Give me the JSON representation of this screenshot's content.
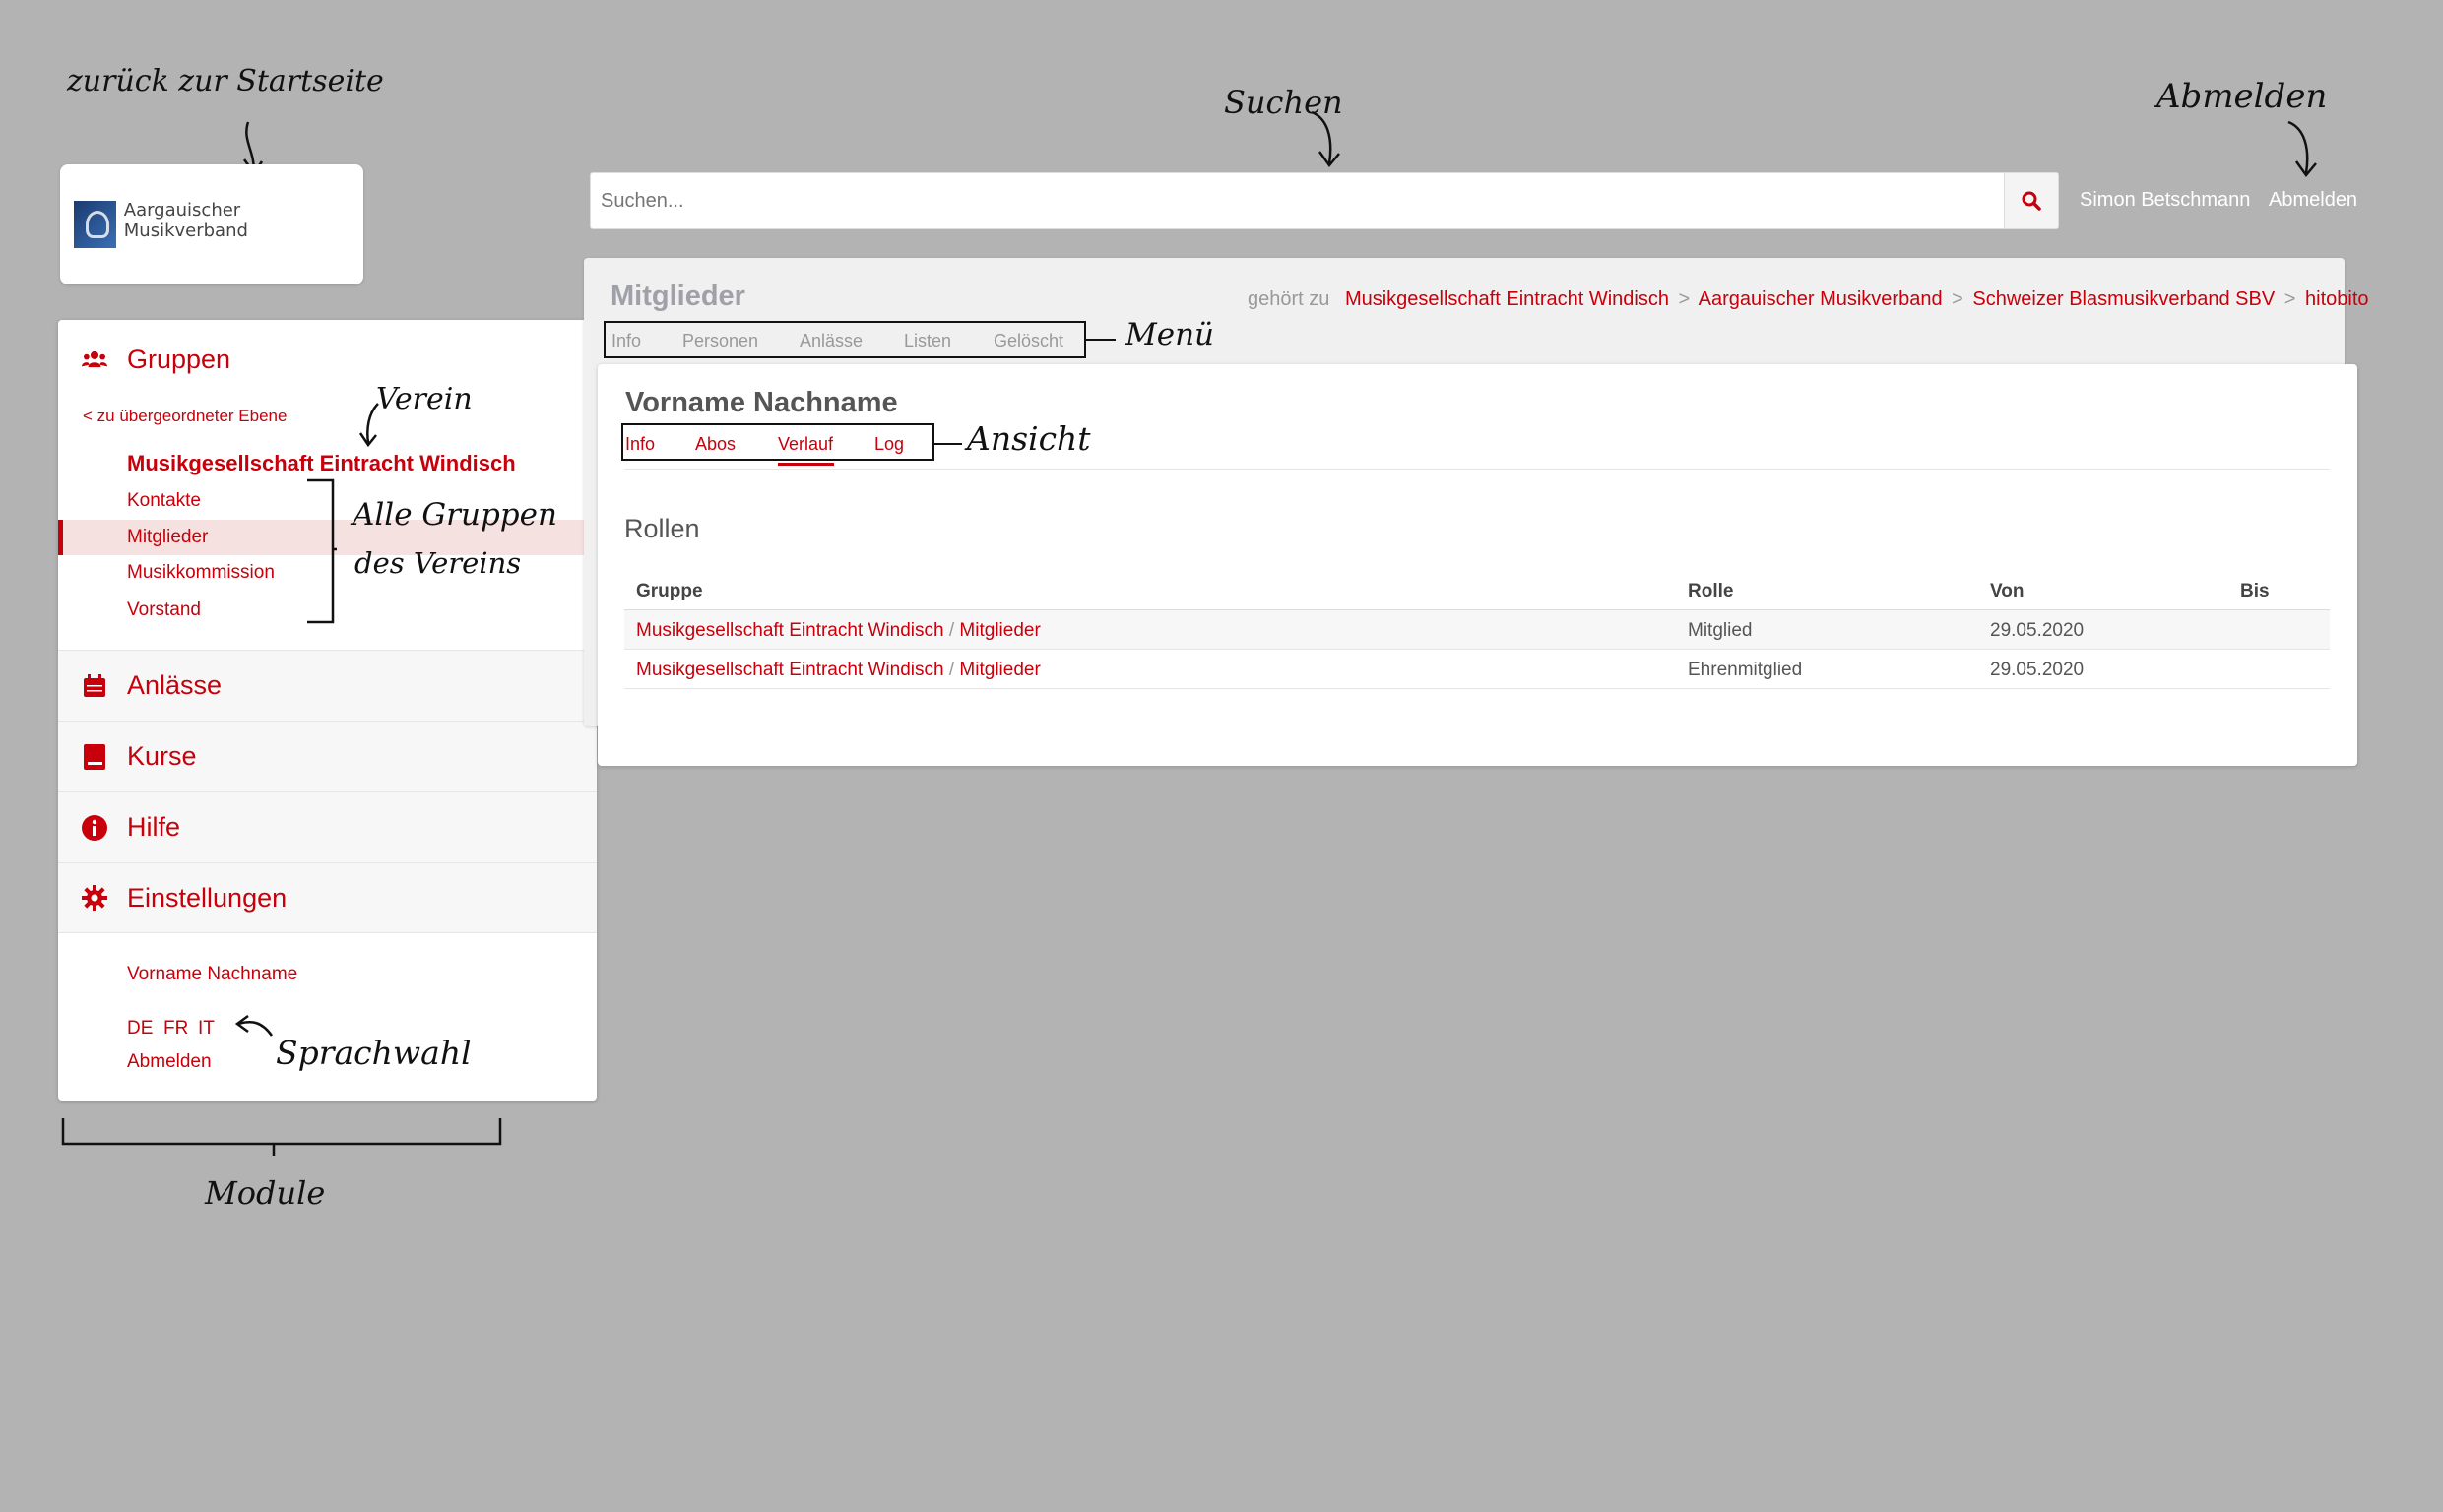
{
  "annotations": {
    "startseite": "zurück zur Startseite",
    "suchen": "Suchen",
    "abmelden": "Abmelden",
    "menu": "Menü",
    "verein": "Verein",
    "alle_gruppen_1": "Alle Gruppen",
    "alle_gruppen_2": "des Vereins",
    "ansicht": "Ansicht",
    "sprachwahl": "Sprachwahl",
    "module": "Module"
  },
  "logo": {
    "text": "Aargauischer Musikverband"
  },
  "search": {
    "placeholder": "Suchen..."
  },
  "header": {
    "user": "Simon Betschmann",
    "logout": "Abmelden"
  },
  "sidebar": {
    "groups_label": "Gruppen",
    "back_link": "< zu übergeordneter Ebene",
    "club_name": "Musikgesellschaft Eintracht Windisch",
    "sub_items": [
      "Kontakte",
      "Mitglieder",
      "Musikkommission",
      "Vorstand"
    ],
    "modules": [
      "Anlässe",
      "Kurse",
      "Hilfe",
      "Einstellungen"
    ],
    "user_name": "Vorname Nachname",
    "langs": [
      "DE",
      "FR",
      "IT"
    ],
    "logout": "Abmelden"
  },
  "page": {
    "title": "Mitglieder",
    "belongs_to": "gehört zu",
    "breadcrumb": [
      "Musikgesellschaft Eintracht Windisch",
      "Aargauischer Musikverband",
      "Schweizer Blasmusikverband SBV",
      "hitobito"
    ],
    "crumb_sep": ">",
    "menu_tabs": [
      "Info",
      "Personen",
      "Anlässe",
      "Listen",
      "Gelöscht"
    ]
  },
  "person": {
    "name": "Vorname Nachname",
    "view_tabs": [
      "Info",
      "Abos",
      "Verlauf",
      "Log"
    ],
    "section_title": "Rollen",
    "columns": [
      "Gruppe",
      "Rolle",
      "Von",
      "Bis"
    ],
    "rows": [
      {
        "group": "Musikgesellschaft Eintracht Windisch",
        "sep": "/",
        "subgroup": "Mitglieder",
        "role": "Mitglied",
        "from": "29.05.2020",
        "to": ""
      },
      {
        "group": "Musikgesellschaft Eintracht Windisch",
        "sep": "/",
        "subgroup": "Mitglieder",
        "role": "Ehrenmitglied",
        "from": "29.05.2020",
        "to": ""
      }
    ]
  },
  "colors": {
    "accent": "#c8000b",
    "background": "#b3b3b3"
  }
}
